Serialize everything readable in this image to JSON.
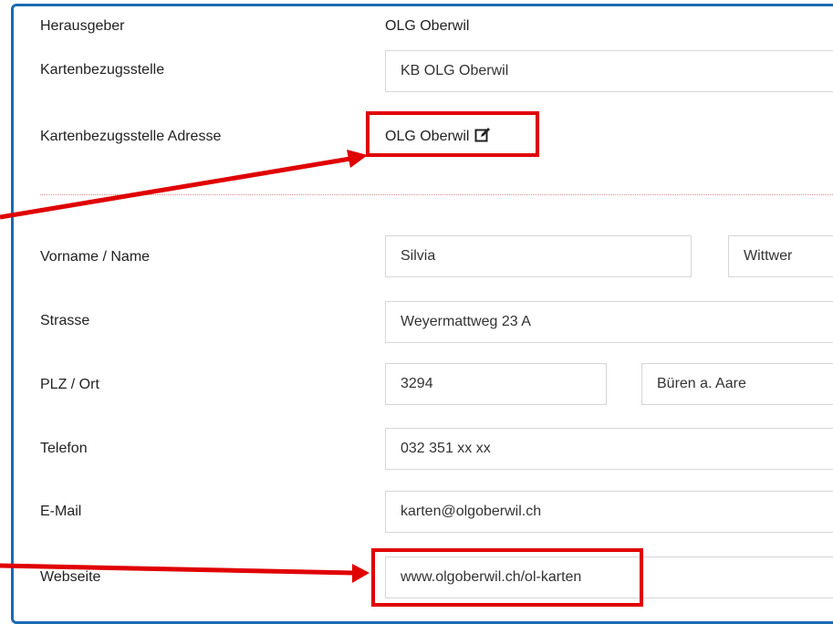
{
  "form": {
    "publisher_label": "Herausgeber",
    "publisher_value": "OLG Oberwil",
    "map_source_label": "Kartenbezugsstelle",
    "map_source_value": "KB OLG Oberwil",
    "map_source_address_label": "Kartenbezugsstelle Adresse",
    "map_source_address_value": "OLG Oberwil",
    "name_label": "Vorname / Name",
    "first_name": "Silvia",
    "last_name": "Wittwer",
    "street_label": "Strasse",
    "street": "Weyermattweg 23 A",
    "zip_city_label": "PLZ / Ort",
    "zip": "3294",
    "city": "Büren a. Aare",
    "phone_label": "Telefon",
    "phone": "032 351 xx xx",
    "email_label": "E-Mail",
    "email": "karten@olgoberwil.ch",
    "website_label": "Webseite",
    "website": "www.olgoberwil.ch/ol-karten"
  },
  "icons": {
    "edit": "edit-icon"
  },
  "colors": {
    "frame": "#1a6bb3",
    "annotation": "#e00000",
    "input_border": "#d6d6d6"
  }
}
